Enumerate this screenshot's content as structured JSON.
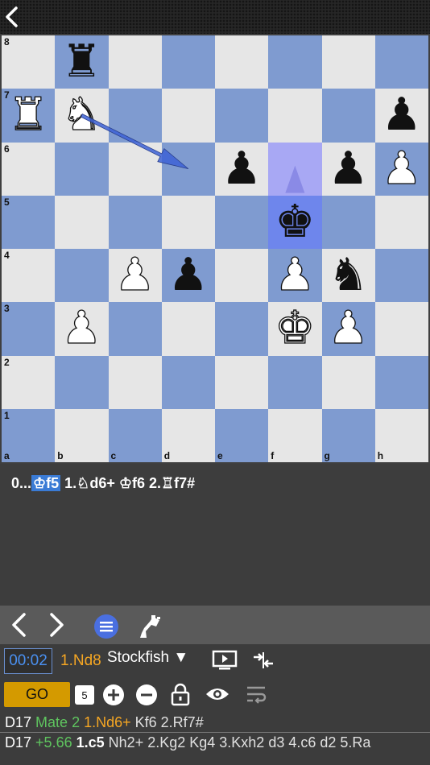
{
  "colors": {
    "light_square": "#e6e6e6",
    "dark_square": "#7f9bd0",
    "highlight": "#3a7bd5",
    "accent_orange": "#f5a623",
    "accent_green": "#5fc45f",
    "timer_blue": "#4a90f0"
  },
  "board": {
    "ranks": [
      "8",
      "7",
      "6",
      "5",
      "4",
      "3",
      "2",
      "1"
    ],
    "files": [
      "a",
      "b",
      "c",
      "d",
      "e",
      "f",
      "g",
      "h"
    ],
    "pieces": [
      {
        "square": "b8",
        "glyph": "♜",
        "color": "black"
      },
      {
        "square": "a7",
        "glyph": "♜",
        "color": "white"
      },
      {
        "square": "b7",
        "glyph": "♞",
        "color": "white"
      },
      {
        "square": "h7",
        "glyph": "♟",
        "color": "black"
      },
      {
        "square": "e6",
        "glyph": "♟",
        "color": "black"
      },
      {
        "square": "g6",
        "glyph": "♟",
        "color": "black"
      },
      {
        "square": "h6",
        "glyph": "♟",
        "color": "white"
      },
      {
        "square": "f5",
        "glyph": "♚",
        "color": "black"
      },
      {
        "square": "c4",
        "glyph": "♟",
        "color": "white"
      },
      {
        "square": "d4",
        "glyph": "♟",
        "color": "black"
      },
      {
        "square": "f4",
        "glyph": "♟",
        "color": "white"
      },
      {
        "square": "g4",
        "glyph": "♞",
        "color": "black"
      },
      {
        "square": "b3",
        "glyph": "♟",
        "color": "white"
      },
      {
        "square": "f3",
        "glyph": "♚",
        "color": "white"
      },
      {
        "square": "g3",
        "glyph": "♟",
        "color": "white"
      }
    ],
    "highlight_squares": [
      "f6",
      "f5"
    ],
    "arrow": {
      "from": "b7",
      "to": "d6"
    }
  },
  "moves": {
    "prefix": "0...",
    "current": "♔f5",
    "rest": " 1.♘d6+  ♔f6  2.♖f7#"
  },
  "nav": {
    "icons": [
      "chevron-left-icon",
      "chevron-right-icon",
      "menu-icon",
      "engine-arm-icon"
    ]
  },
  "engine": {
    "timer": "00:02",
    "best_move": "1.Nd8",
    "name": "Stockfish ▼",
    "go_label": "GO",
    "depth": "5",
    "line1": {
      "code": "D17",
      "score": "Mate 2",
      "first": "1.Nd6+",
      "rest": "Kf6 2.Rf7#"
    },
    "line2": {
      "code": "D17",
      "score": "+5.66",
      "first": "1.c5",
      "rest": "Nh2+ 2.Kg2 Kg4 3.Kxh2 d3 4.c6 d2 5.Ra"
    }
  }
}
